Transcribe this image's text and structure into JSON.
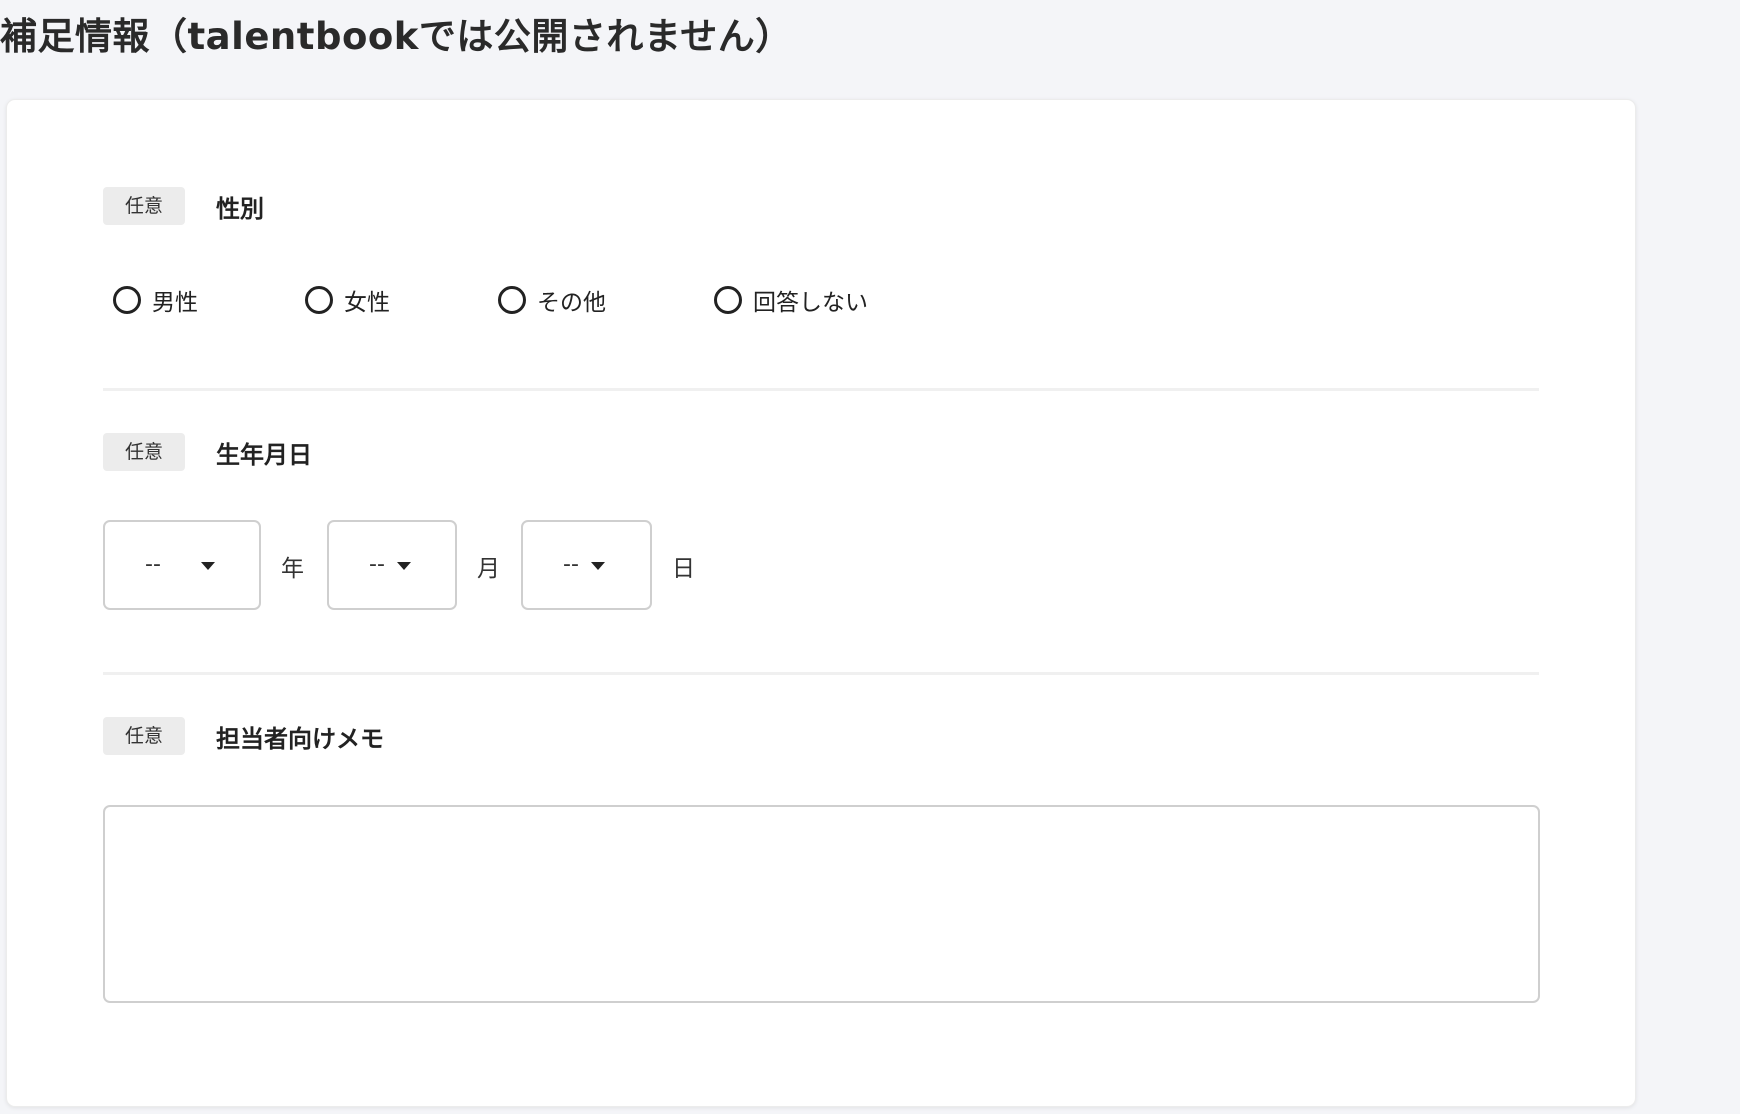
{
  "page": {
    "title": "補足情報（talentbookでは公開されません）"
  },
  "gender": {
    "badge": "任意",
    "label": "性別",
    "options": [
      {
        "label": "男性",
        "selected": false
      },
      {
        "label": "女性",
        "selected": false
      },
      {
        "label": "その他",
        "selected": false
      },
      {
        "label": "回答しない",
        "selected": false
      }
    ]
  },
  "birthdate": {
    "badge": "任意",
    "label": "生年月日",
    "year": {
      "value": "--",
      "unit": "年"
    },
    "month": {
      "value": "--",
      "unit": "月"
    },
    "day": {
      "value": "--",
      "unit": "日"
    }
  },
  "memo": {
    "badge": "任意",
    "label": "担当者向けメモ",
    "value": "",
    "placeholder": ""
  },
  "colors": {
    "page_background": "#f4f5f8",
    "card_background": "#ffffff",
    "badge_background": "#ececec",
    "border": "#cfcfcf",
    "text": "#222222"
  }
}
